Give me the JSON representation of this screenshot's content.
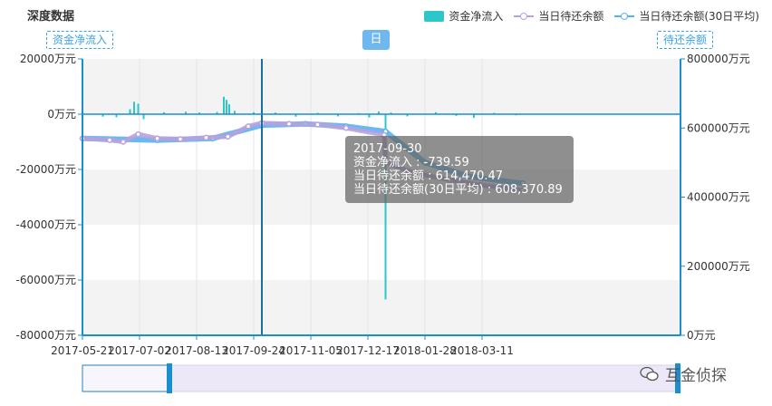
{
  "chart_data": {
    "type": "bar+line",
    "title": "深度数据",
    "x_ticks": [
      "2017-05-21",
      "2017-07-02",
      "2017-08-13",
      "2017-09-24",
      "2017-11-05",
      "2017-12-17",
      "2018-01-28",
      "2018-03-11"
    ],
    "left_axis": {
      "ticks": [
        "20000万元",
        "0万元",
        "-20000万元",
        "-40000万元",
        "-60000万元",
        "-80000万元"
      ],
      "ylim": [
        -80000,
        20000
      ]
    },
    "right_axis": {
      "ticks": [
        "800000万元",
        "600000万元",
        "400000万元",
        "200000万元",
        "0万元"
      ],
      "ylim": [
        0,
        800000
      ]
    },
    "series": [
      {
        "name": "资金净流入",
        "type": "bar",
        "color": "#2ec7c9",
        "points": [
          [
            "2017-05-21",
            300
          ],
          [
            "2017-06-05",
            -900
          ],
          [
            "2017-06-15",
            -1100
          ],
          [
            "2017-06-25",
            1800
          ],
          [
            "2017-06-28",
            4500
          ],
          [
            "2017-07-01",
            3800
          ],
          [
            "2017-07-05",
            -1800
          ],
          [
            "2017-07-20",
            700
          ],
          [
            "2017-08-05",
            900
          ],
          [
            "2017-08-15",
            600
          ],
          [
            "2017-08-28",
            800
          ],
          [
            "2017-09-02",
            6300
          ],
          [
            "2017-09-04",
            5200
          ],
          [
            "2017-09-06",
            3600
          ],
          [
            "2017-09-10",
            1200
          ],
          [
            "2017-09-24",
            700
          ],
          [
            "2017-09-30",
            -739.59
          ],
          [
            "2017-10-10",
            600
          ],
          [
            "2017-10-25",
            -900
          ],
          [
            "2017-11-10",
            500
          ],
          [
            "2017-11-25",
            -800
          ],
          [
            "2017-12-10",
            400
          ],
          [
            "2017-12-18",
            -1200
          ],
          [
            "2017-12-25",
            1000
          ],
          [
            "2017-12-30",
            -67000
          ],
          [
            "2018-01-03",
            600
          ],
          [
            "2018-01-15",
            -800
          ],
          [
            "2018-02-05",
            700
          ],
          [
            "2018-02-20",
            -600
          ],
          [
            "2018-03-05",
            -1300
          ],
          [
            "2018-03-20",
            500
          ],
          [
            "2018-04-05",
            -400
          ]
        ]
      },
      {
        "name": "当日待还余额",
        "type": "line",
        "color": "#b6a2de",
        "points": [
          [
            "2017-05-21",
            570000
          ],
          [
            "2017-06-10",
            565000
          ],
          [
            "2017-06-20",
            560000
          ],
          [
            "2017-07-01",
            582000
          ],
          [
            "2017-07-15",
            570000
          ],
          [
            "2017-08-01",
            568000
          ],
          [
            "2017-08-20",
            572000
          ],
          [
            "2017-09-05",
            575000
          ],
          [
            "2017-09-20",
            605000
          ],
          [
            "2017-09-30",
            614470.47
          ],
          [
            "2017-10-20",
            612000
          ],
          [
            "2017-11-10",
            610000
          ],
          [
            "2017-12-01",
            600000
          ],
          [
            "2017-12-29",
            580000
          ],
          [
            "2017-12-30",
            500000
          ],
          [
            "2018-01-20",
            470000
          ],
          [
            "2018-02-15",
            450000
          ],
          [
            "2018-03-10",
            435000
          ],
          [
            "2018-04-10",
            420000
          ]
        ]
      },
      {
        "name": "当日待还余额(30日平均)",
        "type": "line",
        "color": "#5ab1ef",
        "points": [
          [
            "2017-05-21",
            570000
          ],
          [
            "2017-07-15",
            565000
          ],
          [
            "2017-08-25",
            570000
          ],
          [
            "2017-09-30",
            608370.89
          ],
          [
            "2017-11-01",
            612000
          ],
          [
            "2017-12-01",
            605000
          ],
          [
            "2017-12-30",
            590000
          ],
          [
            "2018-01-28",
            500000
          ],
          [
            "2018-03-01",
            460000
          ],
          [
            "2018-04-10",
            440000
          ]
        ]
      }
    ],
    "tooltip": {
      "date": "2017-09-30",
      "lines": [
        "资金净流入 : -739.59",
        "当日待还余额 : 614,470.47",
        "当日待还余额(30日平均) : 608,370.89"
      ]
    }
  },
  "ui": {
    "axis_label_left": "资金净流入",
    "axis_label_right": "待还余额",
    "period_button": "日",
    "watermark": "互金侦探"
  }
}
